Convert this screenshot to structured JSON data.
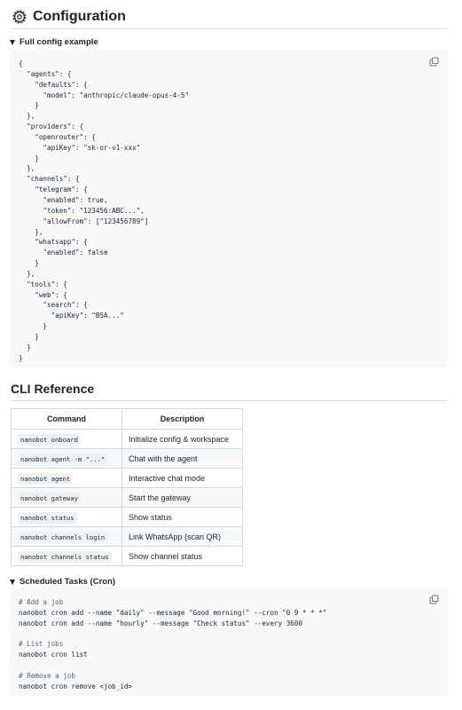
{
  "config": {
    "title": "Configuration",
    "icon": "gear-icon",
    "summary": "Full config example",
    "copy_icon": "copy-icon",
    "code_lines": [
      "{",
      "  \"agents\": {",
      "    \"defaults\": {",
      "      \"model\": \"anthropic/claude-opus-4-5\"",
      "    }",
      "  },",
      "  \"providers\": {",
      "    \"openrouter\": {",
      "      \"apiKey\": \"sk-or-v1-xxx\"",
      "    }",
      "  },",
      "  \"channels\": {",
      "    \"telegram\": {",
      "      \"enabled\": true,",
      "      \"token\": \"123456:ABC...\",",
      "      \"allowFrom\": [\"123456789\"]",
      "    },",
      "    \"whatsapp\": {",
      "      \"enabled\": false",
      "    }",
      "  },",
      "  \"tools\": {",
      "    \"web\": {",
      "      \"search\": {",
      "        \"apiKey\": \"BSA...\"",
      "      }",
      "    }",
      "  }",
      "}"
    ]
  },
  "cli": {
    "title": "CLI Reference",
    "headers": [
      "Command",
      "Description"
    ],
    "rows": [
      {
        "command": "nanobot onboard",
        "description": "Initialize config & workspace"
      },
      {
        "command": "nanobot agent -m \"...\"",
        "description": "Chat with the agent"
      },
      {
        "command": "nanobot agent",
        "description": "Interactive chat mode"
      },
      {
        "command": "nanobot gateway",
        "description": "Start the gateway"
      },
      {
        "command": "nanobot status",
        "description": "Show status"
      },
      {
        "command": "nanobot channels login",
        "description": "Link WhatsApp (scan QR)"
      },
      {
        "command": "nanobot channels status",
        "description": "Show channel status"
      }
    ]
  },
  "cron": {
    "summary": "Scheduled Tasks (Cron)",
    "copy_icon": "copy-icon",
    "code_lines": [
      "# Add a job",
      "nanobot cron add --name \"daily\" --message \"Good morning!\" --cron \"0 9 * * *\"",
      "nanobot cron add --name \"hourly\" --message \"Check status\" --every 3600",
      "",
      "# List jobs",
      "nanobot cron list",
      "",
      "# Remove a job",
      "nanobot cron remove <job_id>"
    ]
  }
}
